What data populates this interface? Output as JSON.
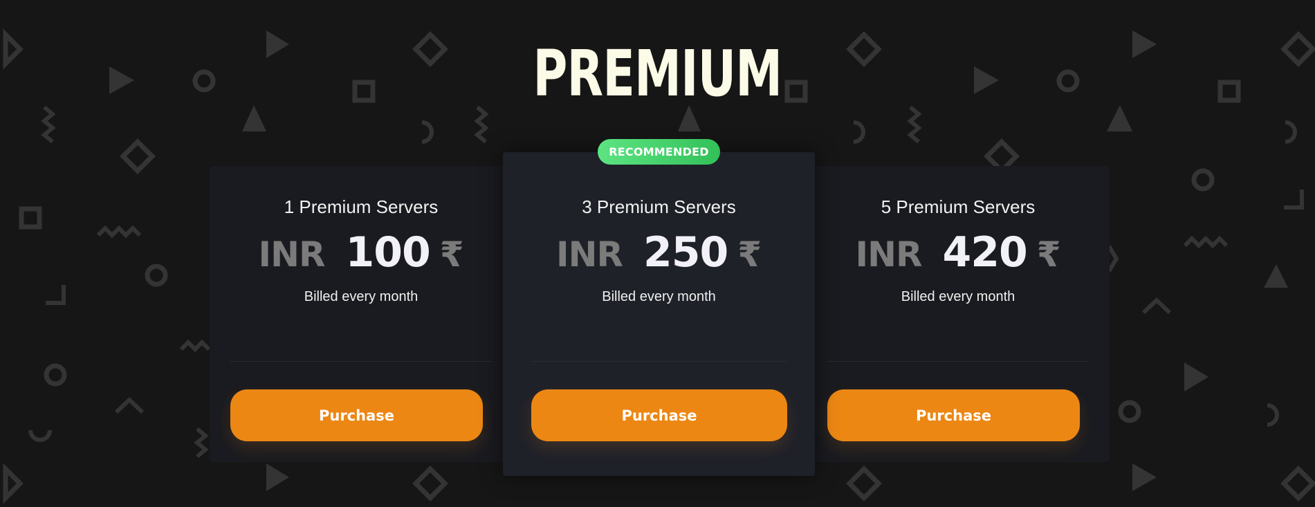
{
  "page": {
    "title": "PREMIUM",
    "badge": "RECOMMENDED"
  },
  "plans": [
    {
      "name": "1 Premium Servers",
      "currency": "INR",
      "amount": "100",
      "currency_symbol": "₹",
      "billing": "Billed every month",
      "button_label": "Purchase"
    },
    {
      "name": "3 Premium Servers",
      "currency": "INR",
      "amount": "250",
      "currency_symbol": "₹",
      "billing": "Billed every month",
      "button_label": "Purchase",
      "recommended": true
    },
    {
      "name": "5 Premium Servers",
      "currency": "INR",
      "amount": "420",
      "currency_symbol": "₹",
      "billing": "Billed every month",
      "button_label": "Purchase"
    }
  ],
  "colors": {
    "background": "#161616",
    "title": "#fbfbe7",
    "card": "#1a1b20",
    "card_recommended": "#1f2129",
    "button": "#ec8714",
    "badge_start": "#5ce482",
    "badge_end": "#33c058",
    "muted_text": "#7b7b7b",
    "pattern": "#343434"
  }
}
